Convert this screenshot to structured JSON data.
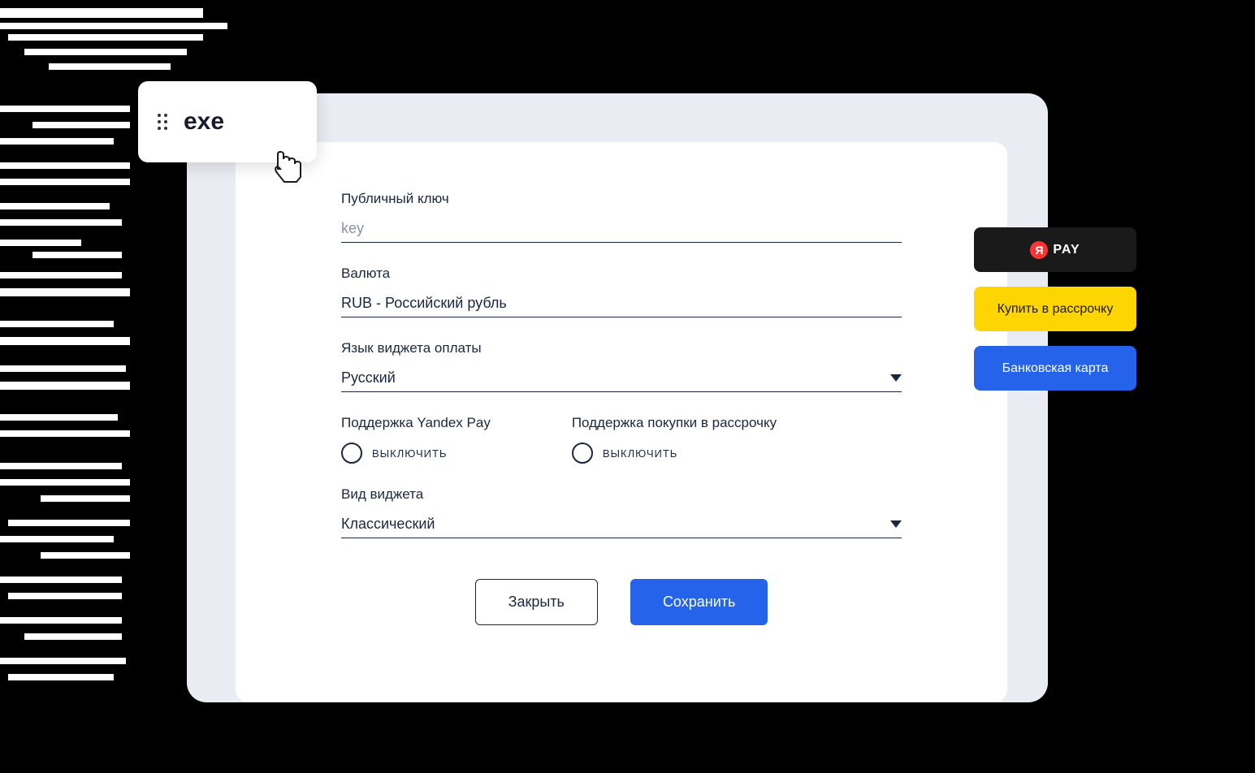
{
  "exe_label": "exe",
  "form": {
    "public_key": {
      "label": "Публичный ключ",
      "placeholder": "key"
    },
    "currency": {
      "label": "Валюта",
      "value": "RUB - Российский рубль"
    },
    "widget_language": {
      "label": "Язык виджета оплаты",
      "value": "Русский"
    },
    "yandex_pay": {
      "label": "Поддержка Yandex Pay",
      "status": "выключить"
    },
    "installment": {
      "label": "Поддержка покупки в рассрочку",
      "status": "выключить"
    },
    "widget_type": {
      "label": "Вид виджета",
      "value": "Классический"
    },
    "close_button": "Закрыть",
    "save_button": "Сохранить"
  },
  "side": {
    "pay_y": "Я",
    "pay_text": "PAY",
    "installment": "Купить в рассрочку",
    "card": "Банковская карта"
  }
}
